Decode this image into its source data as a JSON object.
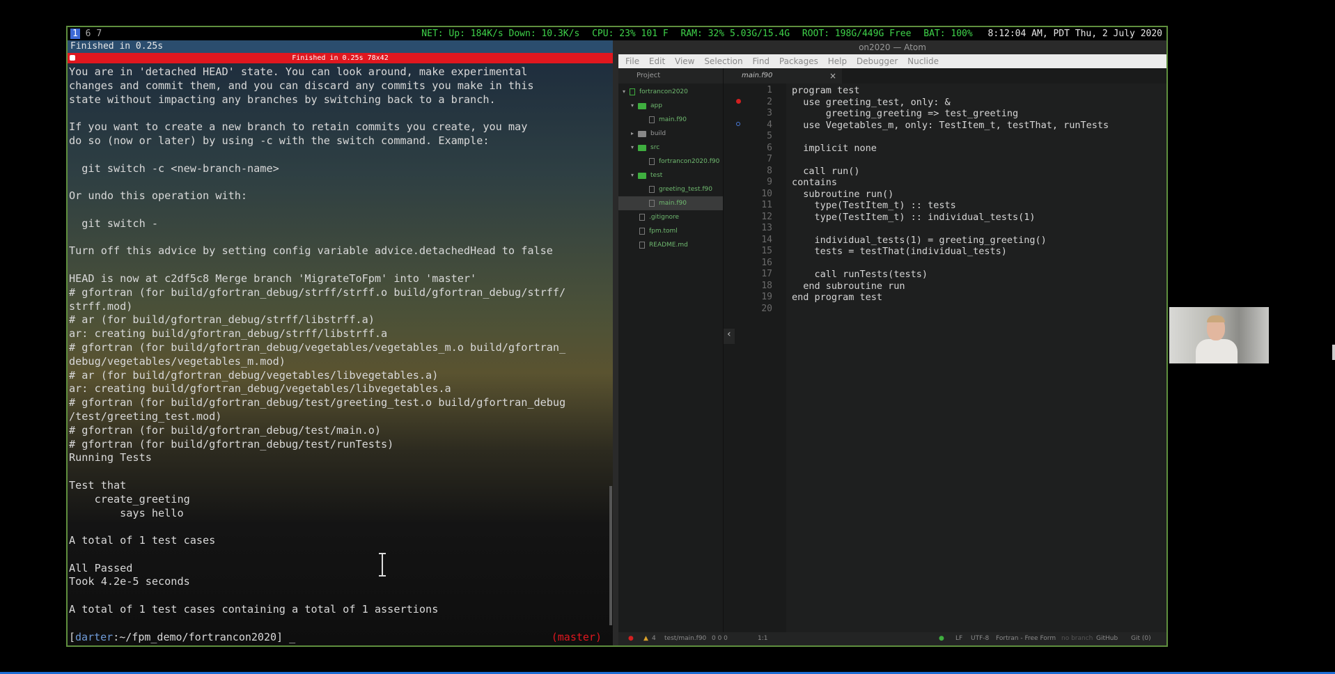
{
  "statusbar": {
    "workspaces": [
      "1",
      "6",
      "7"
    ],
    "net": "NET: Up: 184K/s Down: 10.3K/s",
    "cpu": "CPU: 23% 101 F",
    "ram": "RAM: 32% 5.03G/15.4G",
    "root": "ROOT: 198G/449G Free",
    "bat": "BAT: 100%",
    "clock": "8:12:04 AM, PDT Thu,  2 July 2020"
  },
  "terminal": {
    "title": "Finished in 0.25s",
    "redbar": "Finished in 0.25s 78x42",
    "output": "You are in 'detached HEAD' state. You can look around, make experimental\nchanges and commit them, and you can discard any commits you make in this\nstate without impacting any branches by switching back to a branch.\n\nIf you want to create a new branch to retain commits you create, you may\ndo so (now or later) by using -c with the switch command. Example:\n\n  git switch -c <new-branch-name>\n\nOr undo this operation with:\n\n  git switch -\n\nTurn off this advice by setting config variable advice.detachedHead to false\n\nHEAD is now at c2df5c8 Merge branch 'MigrateToFpm' into 'master'\n# gfortran (for build/gfortran_debug/strff/strff.o build/gfortran_debug/strff/\nstrff.mod)\n# ar (for build/gfortran_debug/strff/libstrff.a)\nar: creating build/gfortran_debug/strff/libstrff.a\n# gfortran (for build/gfortran_debug/vegetables/vegetables_m.o build/gfortran_\ndebug/vegetables/vegetables_m.mod)\n# ar (for build/gfortran_debug/vegetables/libvegetables.a)\nar: creating build/gfortran_debug/vegetables/libvegetables.a\n# gfortran (for build/gfortran_debug/test/greeting_test.o build/gfortran_debug\n/test/greeting_test.mod)\n# gfortran (for build/gfortran_debug/test/main.o)\n# gfortran (for build/gfortran_debug/test/runTests)\nRunning Tests\n\nTest that\n    create_greeting\n        says hello\n\nA total of 1 test cases\n\nAll Passed\nTook 4.2e-5 seconds\n\nA total of 1 test cases containing a total of 1 assertions",
    "prompt_user": "darter",
    "prompt_path": ":~/fpm_demo/fortrancon2020]",
    "branch": "(master)"
  },
  "atom": {
    "title": "on2020 — Atom",
    "menu": [
      "File",
      "Edit",
      "View",
      "Selection",
      "Find",
      "Packages",
      "Help",
      "Debugger",
      "Nuclide"
    ],
    "project_label": "Project",
    "tree": [
      {
        "label": "fortrancon2020",
        "type": "root"
      },
      {
        "label": "app",
        "type": "folder"
      },
      {
        "label": "main.f90",
        "type": "file"
      },
      {
        "label": "build",
        "type": "folder-closed"
      },
      {
        "label": "src",
        "type": "folder"
      },
      {
        "label": "fortrancon2020.f90",
        "type": "file"
      },
      {
        "label": "test",
        "type": "folder"
      },
      {
        "label": "greeting_test.f90",
        "type": "file"
      },
      {
        "label": "main.f90",
        "type": "file-selected"
      },
      {
        "label": ".gitignore",
        "type": "file"
      },
      {
        "label": "fpm.toml",
        "type": "file"
      },
      {
        "label": "README.md",
        "type": "file"
      }
    ],
    "tab_label": "main.f90",
    "tab_close": "×",
    "line_numbers": "1\n2\n3\n4\n5\n6\n7\n8\n9\n10\n11\n12\n13\n14\n15\n16\n17\n18\n19\n20",
    "code": "program test\n  use greeting_test, only: &\n      greeting_greeting => test_greeting\n  use Vegetables_m, only: TestItem_t, testThat, runTests\n\n  implicit none\n\n  call run()\ncontains\n  subroutine run()\n    type(TestItem_t) :: tests\n    type(TestItem_t) :: individual_tests(1)\n\n    individual_tests(1) = greeting_greeting()\n    tests = testThat(individual_tests)\n\n    call runTests(tests)\n  end subroutine run\nend program test",
    "collapse_icon": "‹",
    "status": {
      "warnings": "4",
      "file": "test/main.f90",
      "counts": "0  0  0",
      "position": "1:1",
      "line_ending": "LF",
      "encoding": "UTF-8",
      "grammar": "Fortran - Free Form",
      "branch": "no branch",
      "github": "GitHub",
      "git": "Git (0)"
    }
  },
  "colors": {
    "frame_border": "#5f8f3e",
    "status_green": "#3fd34a",
    "alert_red": "#e0171f",
    "folder_green": "#3fae3f"
  }
}
